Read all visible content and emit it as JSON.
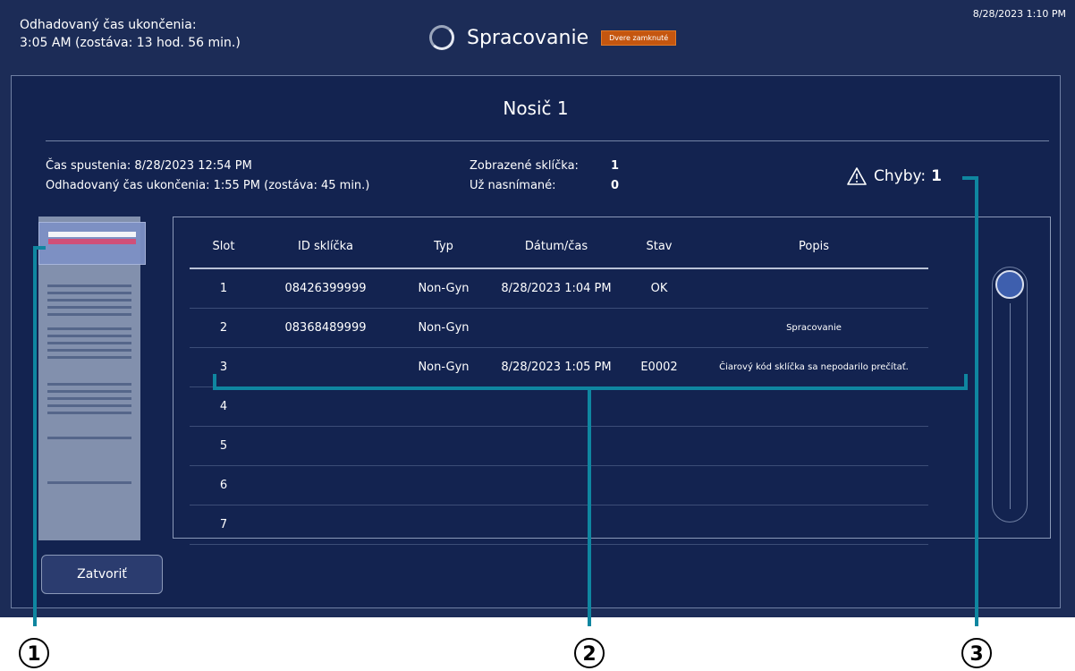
{
  "header": {
    "eta_label": "Odhadovaný čas ukončenia:",
    "eta_value": "3:05 AM (zostáva: 13 hod. 56 min.)",
    "status": "Spracovanie",
    "door_badge": "Dvere zamknuté",
    "clock": "8/28/2023 1:10 PM"
  },
  "panel": {
    "title": "Nosič 1",
    "start_time": "Čas spustenia: 8/28/2023 12:54 PM",
    "eta": "Odhadovaný čas ukončenia: 1:55 PM (zostáva: 45 min.)",
    "shown_slides_label": "Zobrazené sklíčka:",
    "shown_slides_value": "1",
    "scanned_label": "Už nasnímané:",
    "scanned_value": "0",
    "errors_label": "Chyby:",
    "errors_value": "1",
    "close_button": "Zatvoriť"
  },
  "table": {
    "headers": [
      "Slot",
      "ID sklíčka",
      "Typ",
      "Dátum/čas",
      "Stav",
      "Popis"
    ],
    "rows": [
      [
        "1",
        "08426399999",
        "Non-Gyn",
        "8/28/2023 1:04 PM",
        "OK",
        ""
      ],
      [
        "2",
        "08368489999",
        "Non-Gyn",
        "",
        "",
        "Spracovanie"
      ],
      [
        "3",
        "",
        "Non-Gyn",
        "8/28/2023 1:05 PM",
        "E0002",
        "Čiarový kód sklíčka sa nepodarilo prečítať."
      ],
      [
        "4",
        "",
        "",
        "",
        "",
        ""
      ],
      [
        "5",
        "",
        "",
        "",
        "",
        ""
      ],
      [
        "6",
        "",
        "",
        "",
        "",
        ""
      ],
      [
        "7",
        "",
        "",
        "",
        "",
        ""
      ]
    ]
  },
  "callouts": [
    "1",
    "2",
    "3"
  ],
  "icons": {
    "spinner": "loading-spinner-icon",
    "warning": "warning-triangle-icon"
  },
  "colors": {
    "background": "#1c2c57",
    "accent": "#0f86a0",
    "badge": "#c5560f",
    "selected_slide": "#d05079"
  }
}
